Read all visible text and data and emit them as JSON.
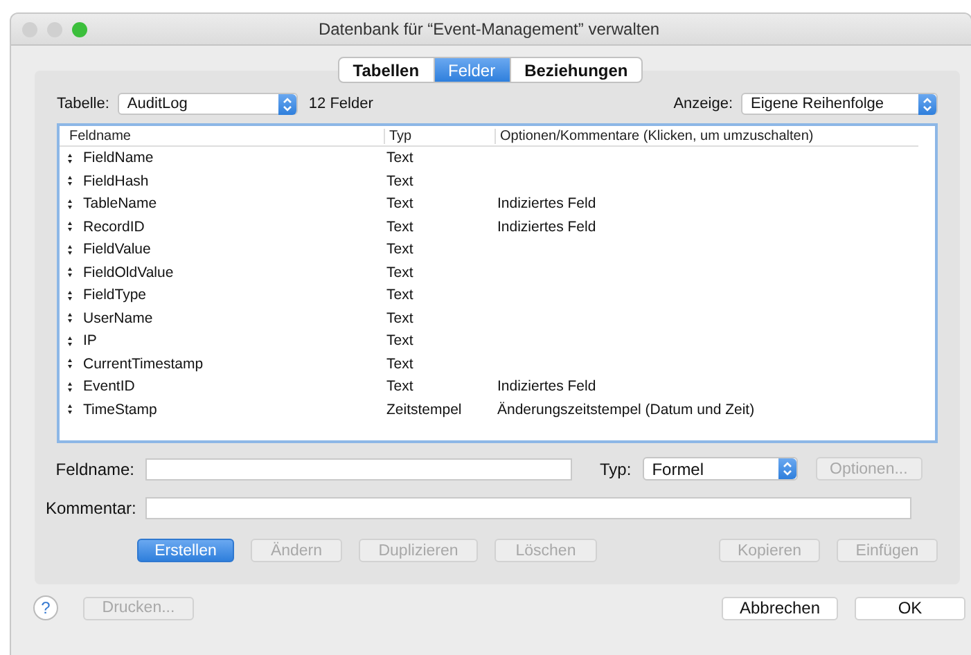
{
  "window": {
    "title": "Datenbank für “Event-Management” verwalten"
  },
  "tabs": [
    {
      "label": "Tabellen",
      "selected": false
    },
    {
      "label": "Felder",
      "selected": true
    },
    {
      "label": "Beziehungen",
      "selected": false
    }
  ],
  "table_picker": {
    "label": "Tabelle:",
    "value": "AuditLog",
    "count": "12 Felder"
  },
  "view_picker": {
    "label": "Anzeige:",
    "value": "Eigene Reihenfolge"
  },
  "columns": [
    "Feldname",
    "Typ",
    "Optionen/Kommentare   (Klicken, um umzuschalten)"
  ],
  "rows": [
    {
      "name": "FieldName",
      "type": "Text"
    },
    {
      "name": "FieldHash",
      "type": "Text"
    },
    {
      "name": "TableName",
      "type": "Text",
      "options": "Indiziertes Feld"
    },
    {
      "name": "RecordID",
      "type": "Text",
      "options": "Indiziertes Feld"
    },
    {
      "name": "FieldValue",
      "type": "Text"
    },
    {
      "name": "FieldOldValue",
      "type": "Text"
    },
    {
      "name": "FieldType",
      "type": "Text"
    },
    {
      "name": "UserName",
      "type": "Text"
    },
    {
      "name": "IP",
      "type": "Text"
    },
    {
      "name": "CurrentTimestamp",
      "type": "Text"
    },
    {
      "name": "EventID",
      "type": "Text",
      "options": "Indiziertes Feld"
    },
    {
      "name": "TimeStamp",
      "type": "Zeitstempel",
      "options": "Änderungszeitstempel (Datum und Zeit)"
    }
  ],
  "form": {
    "name_label": "Feldname:",
    "type_label": "Typ:",
    "type_value": "Formel",
    "options_button": {
      "label": "Optionen...",
      "disabled": true
    },
    "comment_label": "Kommentar:"
  },
  "actions": [
    {
      "label": "Erstellen",
      "default": true,
      "disabled": false
    },
    {
      "label": "Ändern",
      "default": false,
      "disabled": true
    },
    {
      "label": "Duplizieren",
      "default": false,
      "disabled": true
    },
    {
      "label": "Löschen",
      "default": false,
      "disabled": true
    }
  ],
  "clipboard_actions": [
    {
      "label": "Kopieren",
      "disabled": true
    },
    {
      "label": "Einfügen",
      "disabled": true
    }
  ],
  "footer": {
    "help": "?",
    "print": {
      "label": "Drucken...",
      "disabled": true
    },
    "buttons": [
      "Abbrechen",
      "OK"
    ]
  }
}
